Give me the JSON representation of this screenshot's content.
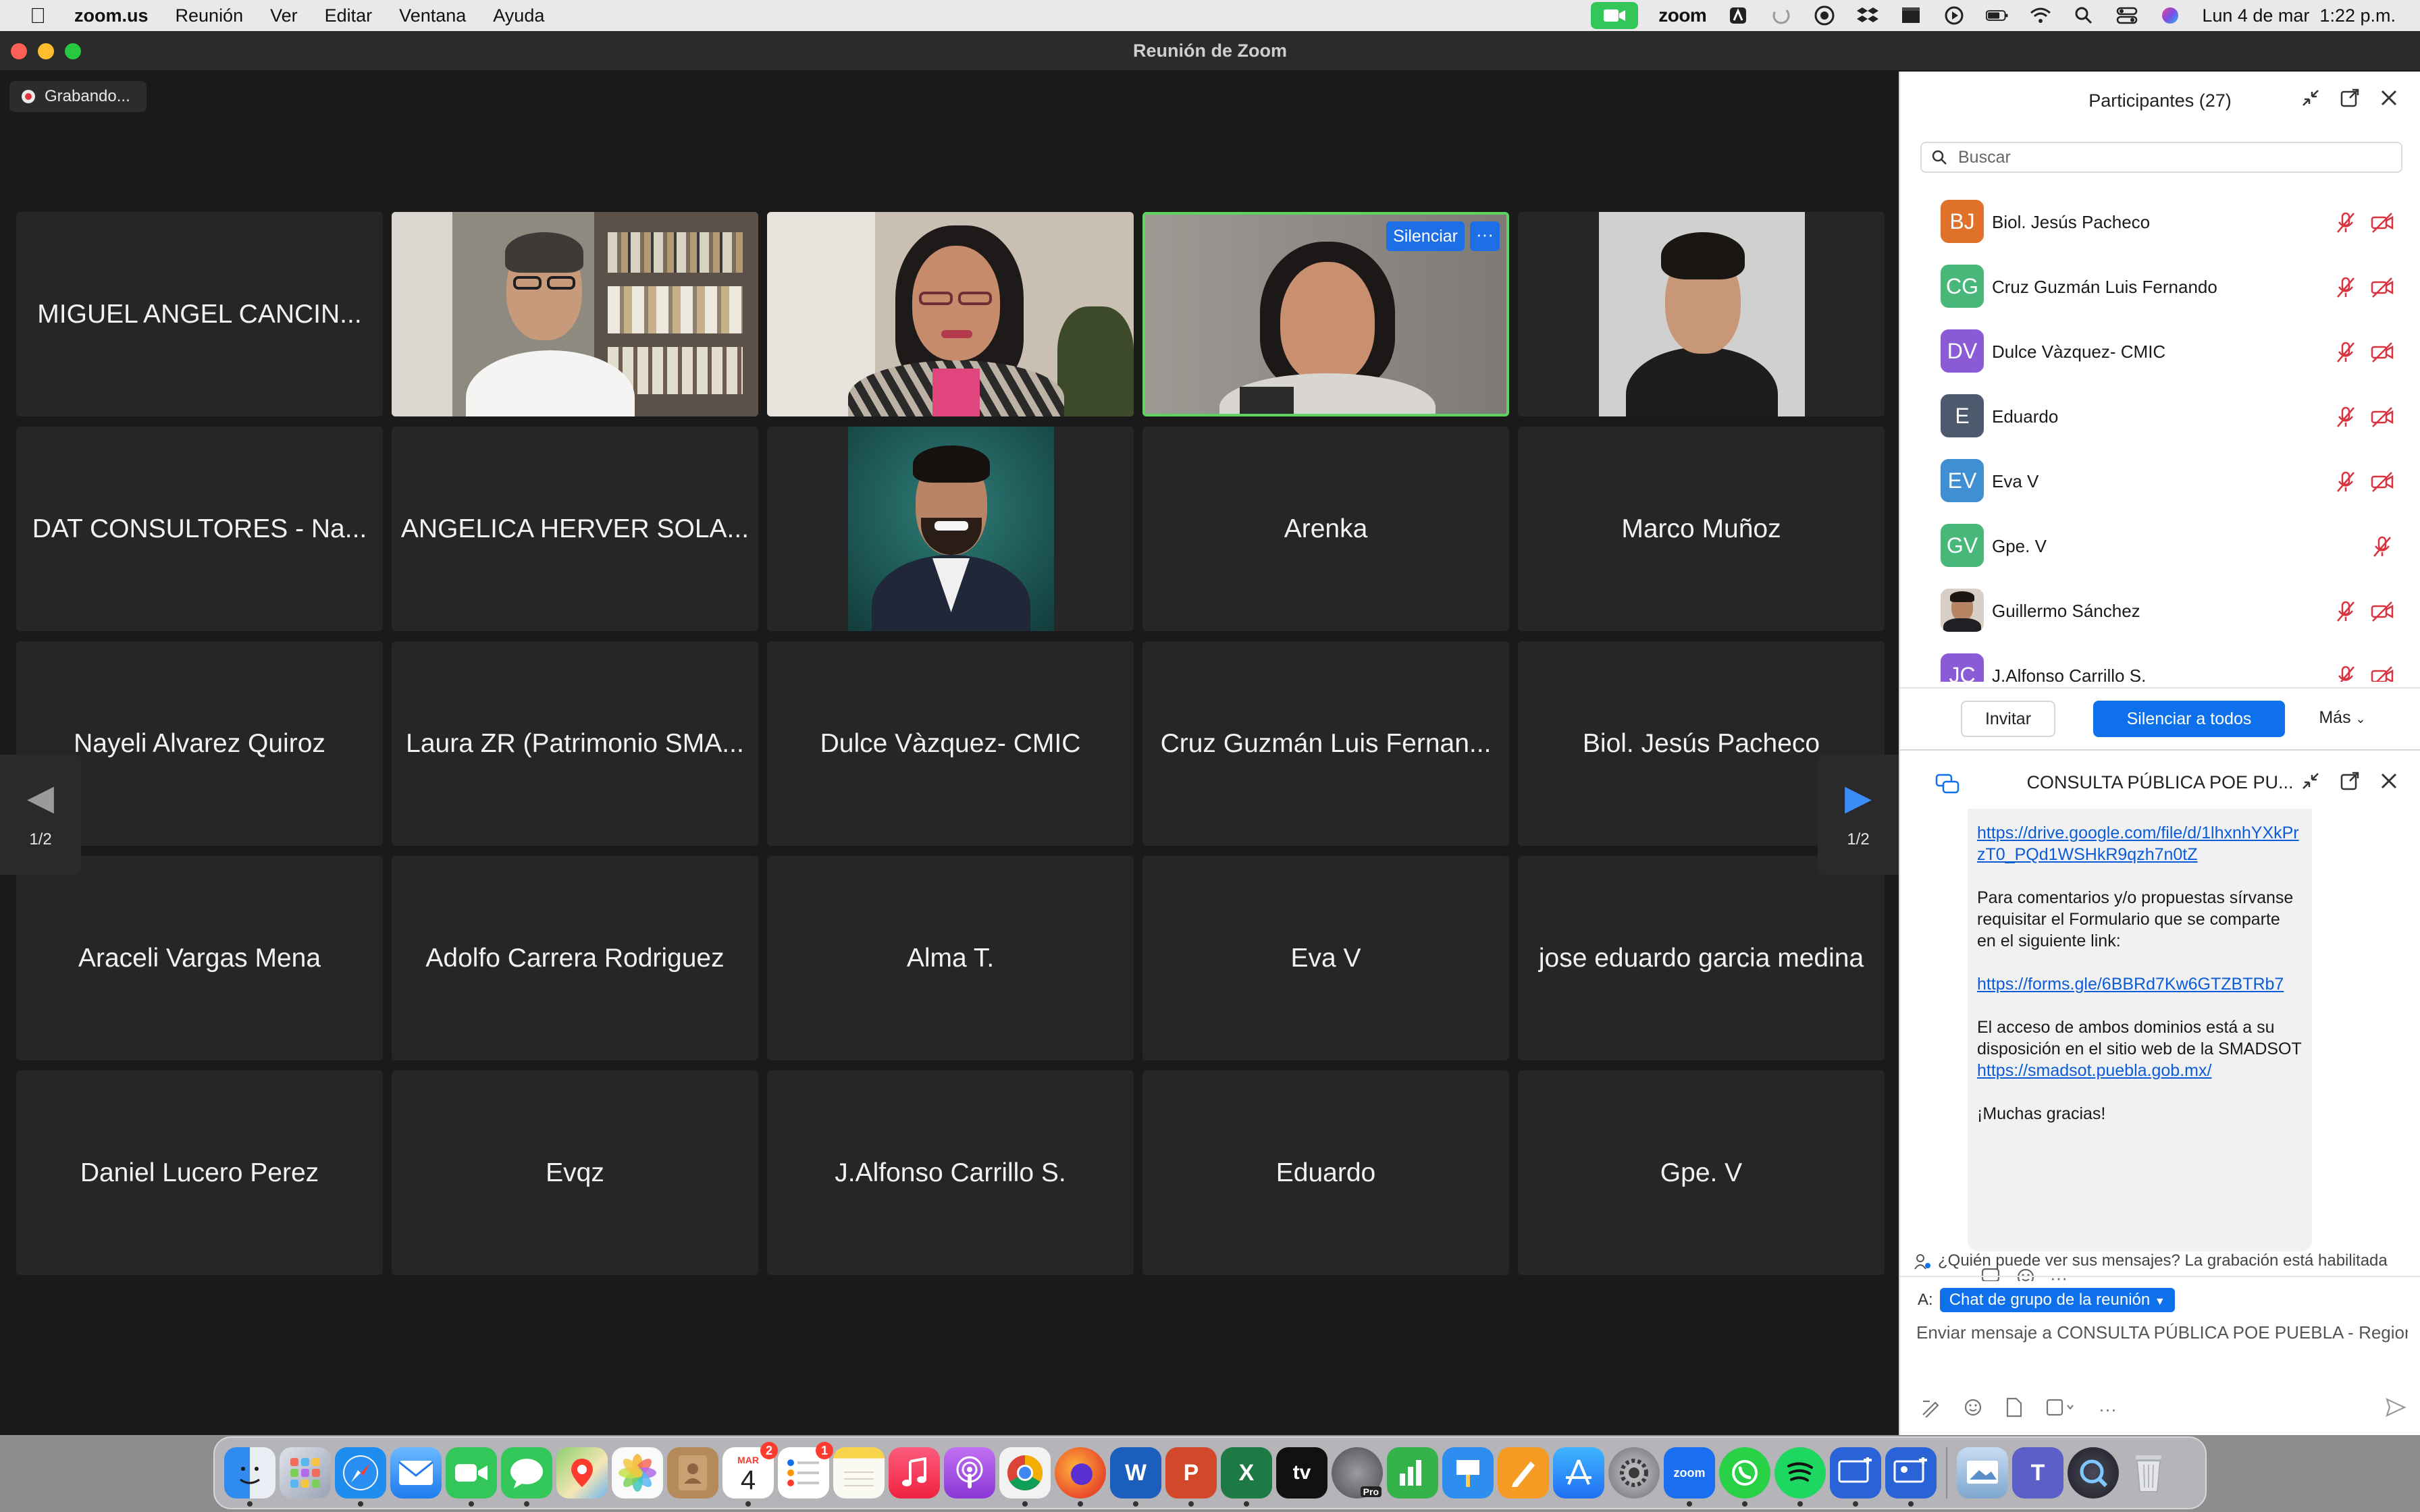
{
  "menubar": {
    "app_name": "zoom.us",
    "menus": [
      "Reunión",
      "Ver",
      "Editar",
      "Ventana",
      "Ayuda"
    ],
    "zoom_label": "zoom",
    "datetime": "Lun 4 de mar  1:22 p.m."
  },
  "window": {
    "title": "Reunión de Zoom",
    "recording_label": "Grabando..."
  },
  "gallery": {
    "page_indicator": "1/2",
    "tiles": [
      {
        "name": "MIGUEL ANGEL CANCIN...",
        "video": false
      },
      {
        "name": "",
        "video": true,
        "video_kind": "man-glasses-bookshelf"
      },
      {
        "name": "",
        "video": true,
        "video_kind": "woman-glasses-pink"
      },
      {
        "name": "",
        "video": true,
        "video_kind": "woman-headset",
        "speaking": true,
        "mute_label": "Silenciar",
        "more_label": "···"
      },
      {
        "name": "",
        "video": true,
        "video_kind": "man-dark-shirt"
      },
      {
        "name": "DAT CONSULTORES - Na...",
        "video": false
      },
      {
        "name": "ANGELICA HERVER SOLA...",
        "video": false
      },
      {
        "name": "",
        "video": true,
        "video_kind": "man-suit-portrait"
      },
      {
        "name": "Arenka",
        "video": false
      },
      {
        "name": "Marco Muñoz",
        "video": false
      },
      {
        "name": "Nayeli Alvarez Quiroz",
        "video": false
      },
      {
        "name": "Laura ZR (Patrimonio SMA...",
        "video": false
      },
      {
        "name": "Dulce Vàzquez- CMIC",
        "video": false
      },
      {
        "name": "Cruz Guzmán Luis Fernan...",
        "video": false
      },
      {
        "name": "Biol. Jesús Pacheco",
        "video": false
      },
      {
        "name": "Araceli Vargas Mena",
        "video": false
      },
      {
        "name": "Adolfo Carrera Rodriguez",
        "video": false
      },
      {
        "name": "Alma T.",
        "video": false
      },
      {
        "name": "Eva V",
        "video": false
      },
      {
        "name": "jose eduardo garcia medina",
        "video": false
      },
      {
        "name": "Daniel Lucero Perez",
        "video": false
      },
      {
        "name": "Evqz",
        "video": false
      },
      {
        "name": "J.Alfonso Carrillo S.",
        "video": false
      },
      {
        "name": "Eduardo",
        "video": false
      },
      {
        "name": "Gpe. V",
        "video": false
      }
    ]
  },
  "participants": {
    "title": "Participantes (27)",
    "search_placeholder": "Buscar",
    "list": [
      {
        "initials": "BJ",
        "name": "Biol. Jesús Pacheco",
        "color": "#e0712b",
        "mic_muted": true,
        "video_off": true
      },
      {
        "initials": "CG",
        "name": "Cruz Guzmán Luis Fernando",
        "color": "#48b87a",
        "mic_muted": true,
        "video_off": true
      },
      {
        "initials": "DV",
        "name": "Dulce Vàzquez- CMIC",
        "color": "#8b5bd6",
        "mic_muted": true,
        "video_off": true
      },
      {
        "initials": "E",
        "name": "Eduardo",
        "color": "#4d5a6e",
        "mic_muted": true,
        "video_off": true
      },
      {
        "initials": "EV",
        "name": "Eva V",
        "color": "#3f8fd2",
        "mic_muted": true,
        "video_off": true
      },
      {
        "initials": "GV",
        "name": "Gpe. V",
        "color": "#48b87a",
        "mic_muted": true,
        "video_off": false
      },
      {
        "initials": "",
        "name": "Guillermo Sánchez",
        "color": "#6b4a3a",
        "mic_muted": true,
        "video_off": true
      },
      {
        "initials": "JC",
        "name": "J.Alfonso Carrillo S.",
        "color": "#8b5bd6",
        "mic_muted": true,
        "video_off": true
      }
    ],
    "invite_label": "Invitar",
    "mute_all_label": "Silenciar a todos",
    "more_label": "Más"
  },
  "chat": {
    "title": "CONSULTA PÚBLICA POE PU...",
    "link1": "https://drive.google.com/file/d/1lhxnhYXkPrzT0_PQd1WSHkR9qzh7n0tZ",
    "text1": "Para comentarios y/o propuestas sírvanse requisitar el Formulario que se comparte en el siguiente link:",
    "link2": "https://forms.gle/6BBRd7Kw6GTZBTRb7",
    "text2": "El acceso de ambos dominios está a su disposición en el sitio web de la SMADSOT",
    "link3": "https://smadsot.puebla.gob.mx/",
    "text3": "¡Muchas gracias!",
    "privacy_text": "¿Quién puede ver sus mensajes? La grabación está habilitada",
    "to_label": "A:",
    "to_value": "Chat de grupo de la reunión",
    "input_placeholder": "Enviar mensaje a CONSULTA PÚBLICA POE PUEBLA - Region..."
  },
  "dock": {
    "calendar_month": "MAR",
    "calendar_day": "4",
    "calendar_badge": "2",
    "reminders_badge": "1",
    "tv_label": "tv",
    "zoom_label": "zoom",
    "pro_label": "Pro",
    "apps": [
      {
        "name": "finder",
        "color": "#2f8bf0"
      },
      {
        "name": "launchpad",
        "color": "#9aa3b5"
      },
      {
        "name": "safari",
        "color": "#1d8df0"
      },
      {
        "name": "mail",
        "color": "#3b93f6"
      },
      {
        "name": "facetime",
        "color": "#33c759"
      },
      {
        "name": "messages",
        "color": "#34c759"
      },
      {
        "name": "maps",
        "color": "#5fb55a"
      },
      {
        "name": "photos",
        "color": "#f2f2f2"
      },
      {
        "name": "contacts",
        "color": "#b58a5a"
      },
      {
        "name": "calendar",
        "color": "#ffffff"
      },
      {
        "name": "reminders",
        "color": "#ffffff"
      },
      {
        "name": "notes",
        "color": "#f7d44a"
      },
      {
        "name": "music",
        "color": "#fa3c55"
      },
      {
        "name": "podcasts",
        "color": "#9b4ee0"
      },
      {
        "name": "chrome",
        "color": "#e8e8e8"
      },
      {
        "name": "firefox",
        "color": "#ff7a1a"
      },
      {
        "name": "word",
        "color": "#1b5ebe"
      },
      {
        "name": "powerpoint",
        "color": "#d2482a"
      },
      {
        "name": "excel",
        "color": "#1d7a45"
      },
      {
        "name": "appletv",
        "color": "#111111"
      },
      {
        "name": "final-cut",
        "color": "#6b6b70"
      },
      {
        "name": "numbers",
        "color": "#35b24a"
      },
      {
        "name": "keynote",
        "color": "#2d8ef0"
      },
      {
        "name": "pages",
        "color": "#f59b23"
      },
      {
        "name": "appstore",
        "color": "#1f8ff3"
      },
      {
        "name": "settings",
        "color": "#8e8e93"
      },
      {
        "name": "zoom",
        "color": "#1a6ff0"
      },
      {
        "name": "whatsapp",
        "color": "#28d146"
      },
      {
        "name": "spotify",
        "color": "#1ed760"
      },
      {
        "name": "screenshare-1",
        "color": "#2a63d8"
      },
      {
        "name": "screenshare-2",
        "color": "#2a63d8"
      },
      {
        "name": "preview",
        "color": "#7fa7d0"
      },
      {
        "name": "teams",
        "color": "#5b5fc7"
      },
      {
        "name": "quicktime",
        "color": "#2e2e38"
      },
      {
        "name": "trash",
        "color": "#d5d7da"
      }
    ]
  }
}
